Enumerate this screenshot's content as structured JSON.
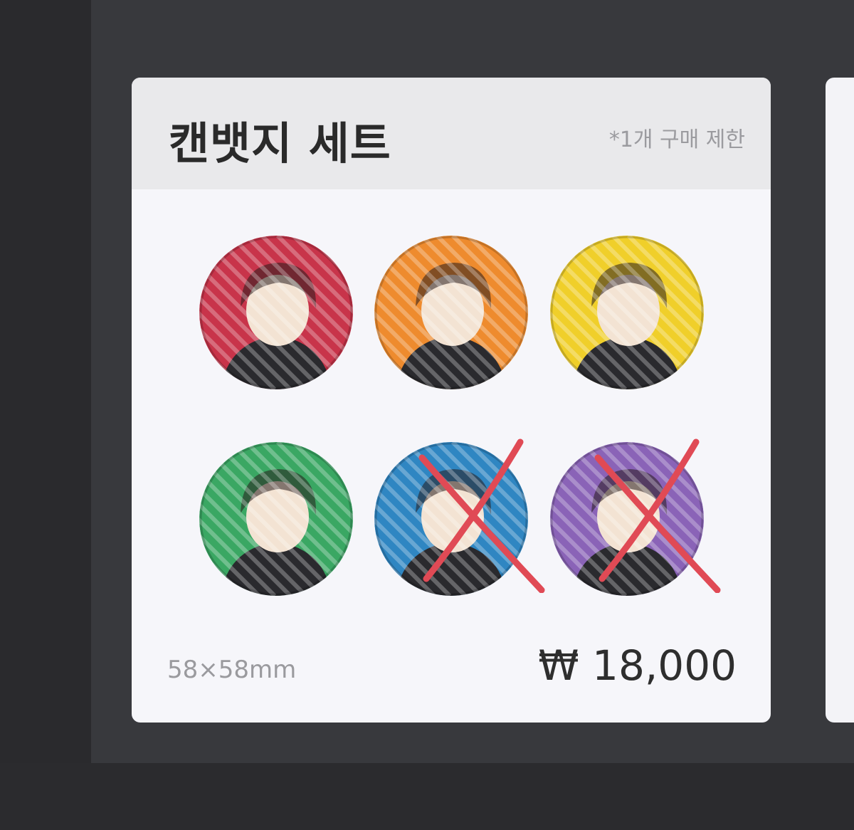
{
  "card": {
    "title": "캔뱃지 세트",
    "limit_note": "*1개 구매 제한",
    "size": "58×58mm",
    "price": "₩ 18,000"
  },
  "badges": [
    {
      "name": "badge-red",
      "color": "#c8344a",
      "sold_out": false
    },
    {
      "name": "badge-orange",
      "color": "#ee8b2e",
      "sold_out": false
    },
    {
      "name": "badge-yellow",
      "color": "#f0cf2a",
      "sold_out": false
    },
    {
      "name": "badge-green",
      "color": "#3aa763",
      "sold_out": false
    },
    {
      "name": "badge-blue",
      "color": "#2f86c2",
      "sold_out": true
    },
    {
      "name": "badge-purple",
      "color": "#8a63b7",
      "sold_out": true
    }
  ],
  "colors": {
    "cross_mark": "#e04a55",
    "background": "#38393d",
    "card": "#f6f6fa"
  }
}
